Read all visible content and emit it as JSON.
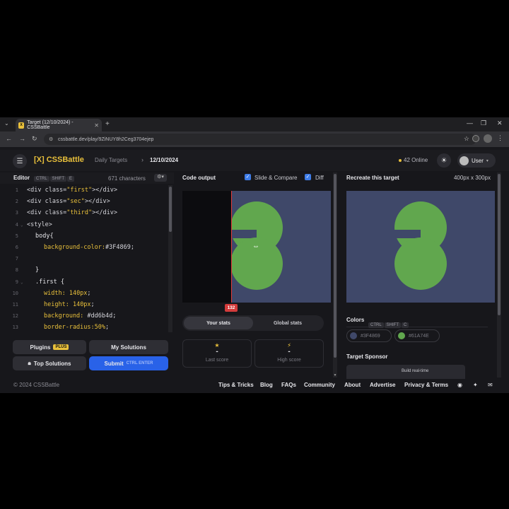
{
  "browser": {
    "tab_title": "Target (12/10/2024) - CSSBattle",
    "favicon_text": "[X]",
    "url": "cssbattle.dev/play/9ZiNUY8h2Ceg3704ejep"
  },
  "header": {
    "logo": "[X] CSSBattle",
    "crumb_parent": "Daily Targets",
    "crumb_current": "12/10/2024",
    "online": "42 Online",
    "user": "User"
  },
  "editor": {
    "title": "Editor",
    "keys": [
      "CTRL",
      "SHIFT",
      "E"
    ],
    "chars": "671 characters",
    "lines": [
      {
        "n": "1",
        "fold": "",
        "indent": 0,
        "parts": [
          {
            "c": "c-tag",
            "t": "<div class="
          },
          {
            "c": "c-str",
            "t": "\"first\""
          },
          {
            "c": "c-tag",
            "t": "></div>"
          }
        ]
      },
      {
        "n": "2",
        "fold": "",
        "indent": 0,
        "parts": [
          {
            "c": "c-tag",
            "t": "<div class="
          },
          {
            "c": "c-str",
            "t": "\"sec\""
          },
          {
            "c": "c-tag",
            "t": "></div>"
          }
        ]
      },
      {
        "n": "3",
        "fold": "",
        "indent": 0,
        "parts": [
          {
            "c": "c-tag",
            "t": "<div class="
          },
          {
            "c": "c-str",
            "t": "\"third\""
          },
          {
            "c": "c-tag",
            "t": "></div>"
          }
        ]
      },
      {
        "n": "4",
        "fold": "⌄",
        "indent": 0,
        "parts": [
          {
            "c": "c-tag",
            "t": "<style>"
          }
        ]
      },
      {
        "n": "5",
        "fold": "",
        "indent": 1,
        "parts": [
          {
            "c": "c-sel",
            "t": "body{"
          }
        ]
      },
      {
        "n": "6",
        "fold": "",
        "indent": 2,
        "parts": [
          {
            "c": "c-prop",
            "t": "background-color:"
          },
          {
            "c": "c-val",
            "t": "#3F4869;"
          }
        ]
      },
      {
        "n": "7",
        "fold": "",
        "indent": 0,
        "parts": []
      },
      {
        "n": "8",
        "fold": "",
        "indent": 1,
        "parts": [
          {
            "c": "c-sel",
            "t": "}"
          }
        ]
      },
      {
        "n": "9",
        "fold": "⌄",
        "indent": 1,
        "parts": [
          {
            "c": "c-sel",
            "t": ".first {"
          }
        ]
      },
      {
        "n": "10",
        "fold": "",
        "indent": 2,
        "parts": [
          {
            "c": "c-prop",
            "t": "width: "
          },
          {
            "c": "c-str",
            "t": "140px"
          },
          {
            "c": "c-val",
            "t": ";"
          }
        ]
      },
      {
        "n": "11",
        "fold": "",
        "indent": 2,
        "parts": [
          {
            "c": "c-prop",
            "t": "height: "
          },
          {
            "c": "c-str",
            "t": "140px"
          },
          {
            "c": "c-val",
            "t": ";"
          }
        ]
      },
      {
        "n": "12",
        "fold": "",
        "indent": 2,
        "parts": [
          {
            "c": "c-prop",
            "t": "background: "
          },
          {
            "c": "c-val",
            "t": "#dd6b4d;"
          }
        ]
      },
      {
        "n": "13",
        "fold": "",
        "indent": 2,
        "parts": [
          {
            "c": "c-prop",
            "t": "border-radius:"
          },
          {
            "c": "c-str",
            "t": "50%"
          },
          {
            "c": "c-val",
            "t": ";"
          }
        ]
      }
    ],
    "btn_plugins": "Plugins",
    "badge_plus": "PLUS",
    "btn_solutions": "My Solutions",
    "btn_top": "Top Solutions",
    "btn_submit": "Submit",
    "submit_keys": "CTRL  ENTER"
  },
  "output": {
    "title": "Code output",
    "slide_label": "Slide & Compare",
    "diff_label": "Diff",
    "slider_value": "132",
    "tab_your": "Your stats",
    "tab_global": "Global stats",
    "last_score_value": "-",
    "last_score_label": "Last score",
    "high_score_value": "-",
    "high_score_label": "High score"
  },
  "target": {
    "title": "Recreate this target",
    "dims": "400px x 300px",
    "colors_title": "Colors",
    "colors_keys": [
      "CTRL",
      "SHIFT",
      "C"
    ],
    "colors": [
      {
        "hex": "#3F4869",
        "label": "#3F4869"
      },
      {
        "hex": "#61A74E",
        "label": "#61A74E"
      }
    ],
    "sponsor_title": "Target Sponsor",
    "sponsor_text": "Build real-time"
  },
  "footer": {
    "copyright": "© 2024 CSSBattle",
    "links": [
      "Tips & Tricks",
      "Blog",
      "FAQs",
      "Community",
      "About",
      "Advertise",
      "Privacy & Terms"
    ]
  }
}
